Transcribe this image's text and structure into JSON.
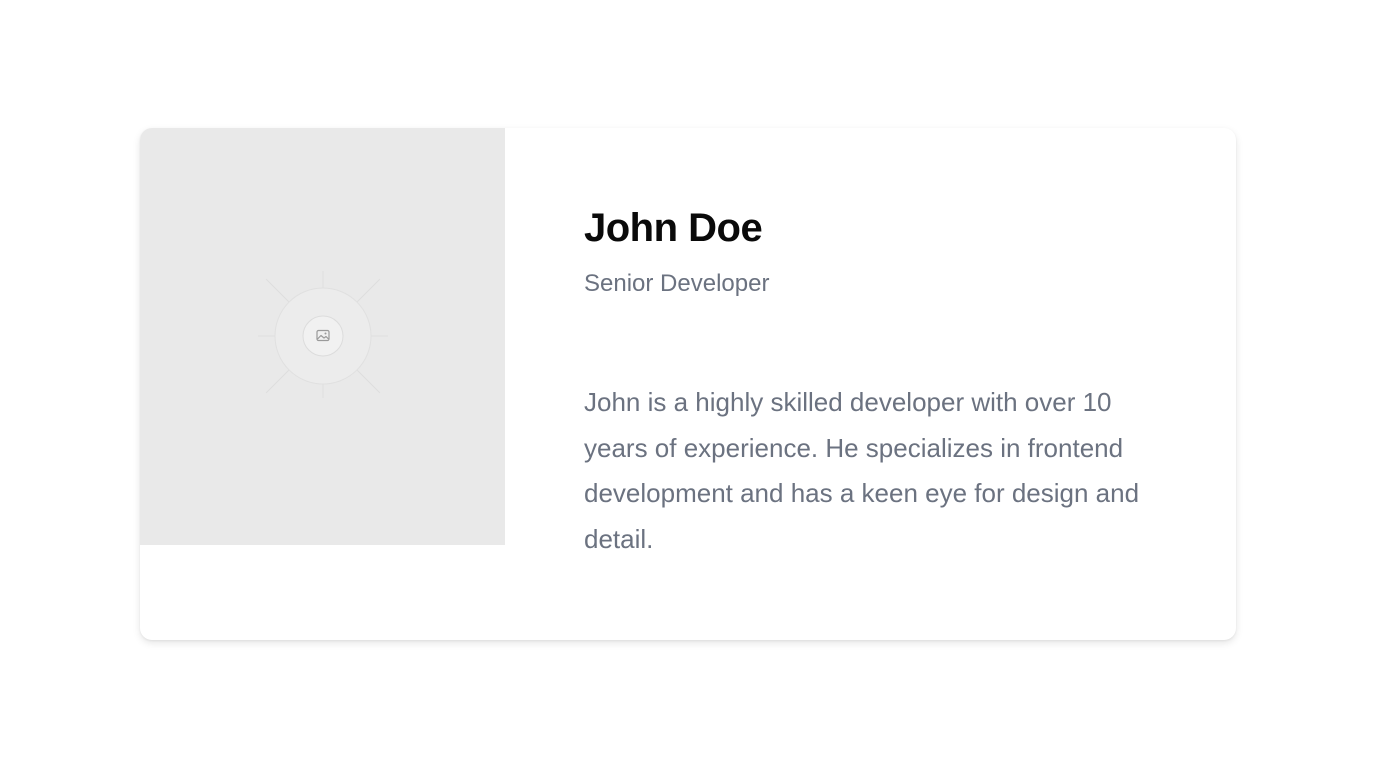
{
  "profile": {
    "name": "John Doe",
    "role": "Senior Developer",
    "bio": "John is a highly skilled developer with over 10 years of experience. He specializes in frontend development and has a keen eye for design and detail.",
    "photo_icon": "image-placeholder-icon"
  },
  "colors": {
    "page_background": "#ffffff",
    "card_background": "#ffffff",
    "photo_background": "#e9e9e9",
    "name_text": "#0a0a0a",
    "secondary_text": "#6b7280"
  }
}
